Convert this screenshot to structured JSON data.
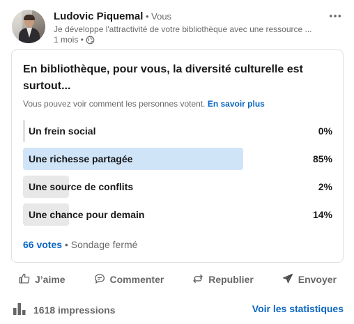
{
  "post": {
    "author_name": "Ludovic Piquemal",
    "author_badge": " • Vous",
    "subtitle": "Je développe l'attractivité de votre bibliothèque avec une ressource ...",
    "time": "1 mois •",
    "globe_icon": "globe-icon",
    "more_icon": "more-horizontal-icon"
  },
  "poll": {
    "question": "En bibliothèque, pour vous, la diversité culturelle est surtout...",
    "note": "Vous pouvez voir comment les personnes votent.",
    "note_link": "En savoir plus",
    "options": [
      {
        "label": "Un frein social",
        "percent_label": "0%",
        "percent": 0,
        "leading": false
      },
      {
        "label": "Une richesse partagée",
        "percent_label": "85%",
        "percent": 85,
        "leading": true
      },
      {
        "label": "Une source de conflits",
        "percent_label": "2%",
        "percent": 2,
        "leading": false
      },
      {
        "label": "Une chance pour demain",
        "percent_label": "14%",
        "percent": 14,
        "leading": false
      }
    ],
    "votes": "66 votes",
    "status": " • Sondage fermé",
    "colors": {
      "leading_bar": "#d0e4f8",
      "other_bar": "#e8e8e8",
      "link": "#0a66c2"
    }
  },
  "actions": [
    {
      "label": "J’aime",
      "icon": "thumbs-up-icon"
    },
    {
      "label": "Commenter",
      "icon": "comment-icon"
    },
    {
      "label": "Republier",
      "icon": "repost-icon"
    },
    {
      "label": "Envoyer",
      "icon": "send-icon"
    }
  ],
  "footer": {
    "impressions": "1618 impressions",
    "impressions_icon": "bar-chart-icon",
    "stats_link": "Voir les statistiques"
  }
}
